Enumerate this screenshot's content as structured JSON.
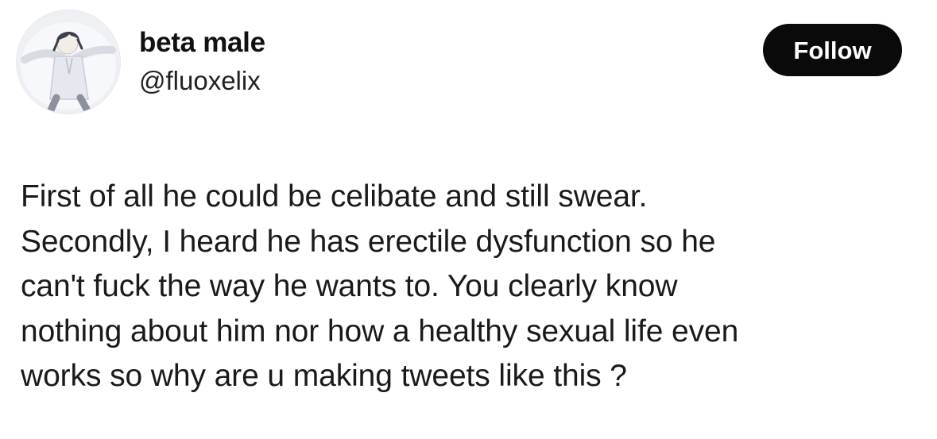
{
  "author": {
    "display_name": "beta male",
    "handle": "@fluoxelix",
    "avatar_icon": "avatar-illustration"
  },
  "follow_button": {
    "label": "Follow",
    "background": "#0a0a0a",
    "text_color": "#ffffff"
  },
  "tweet": {
    "lines": [
      "First of all he could be celibate and still swear.",
      "Secondly, I heard he has erectile dysfunction so he",
      "can't fuck the way he wants to. You clearly know",
      "nothing about him nor how a healthy sexual life even",
      "works so why are u making tweets like this ?"
    ]
  }
}
